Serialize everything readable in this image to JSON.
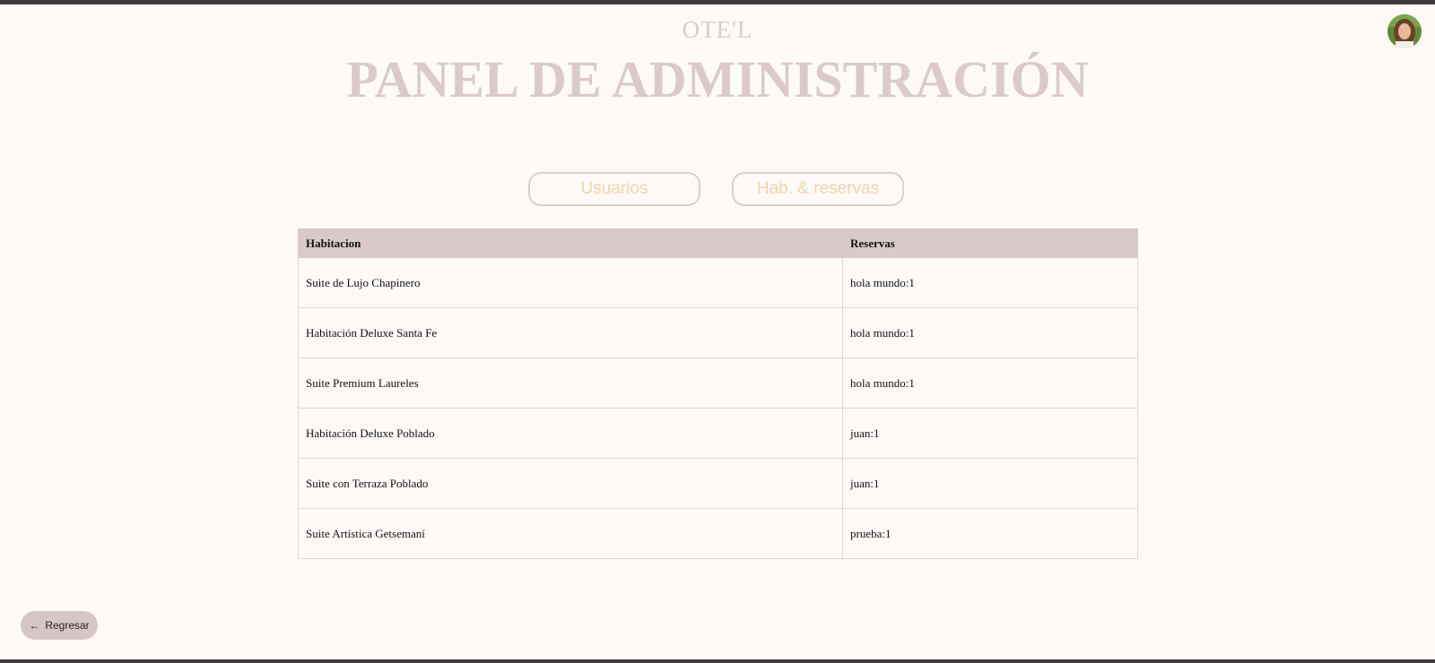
{
  "header": {
    "brand": "OTE'L",
    "title": "PANEL DE ADMINISTRACIÓN"
  },
  "tabs": [
    {
      "label": "Usuarios"
    },
    {
      "label": "Hab. & reservas"
    }
  ],
  "table": {
    "columns": [
      "Habitacion",
      "Reservas"
    ],
    "rows": [
      {
        "habitacion": "Suite de Lujo Chapinero",
        "reservas": "hola mundo:1"
      },
      {
        "habitacion": "Habitación Deluxe Santa Fe",
        "reservas": "hola mundo:1"
      },
      {
        "habitacion": "Suite Premium Laureles",
        "reservas": "hola mundo:1"
      },
      {
        "habitacion": "Habitación Deluxe Poblado",
        "reservas": "juan:1"
      },
      {
        "habitacion": "Suite con Terraza Poblado",
        "reservas": "juan:1"
      },
      {
        "habitacion": "Suite Artística Getsemaní",
        "reservas": "prueba:1"
      }
    ]
  },
  "back_button": {
    "icon": "arrow-left-icon",
    "arrow": "←",
    "label": "Regresar"
  },
  "colors": {
    "background": "#fffaf8",
    "title": "#dccacb",
    "table_header": "#dbc9ca",
    "tab_text": "#f3d3aa",
    "button_bg": "#d6c6c6"
  }
}
